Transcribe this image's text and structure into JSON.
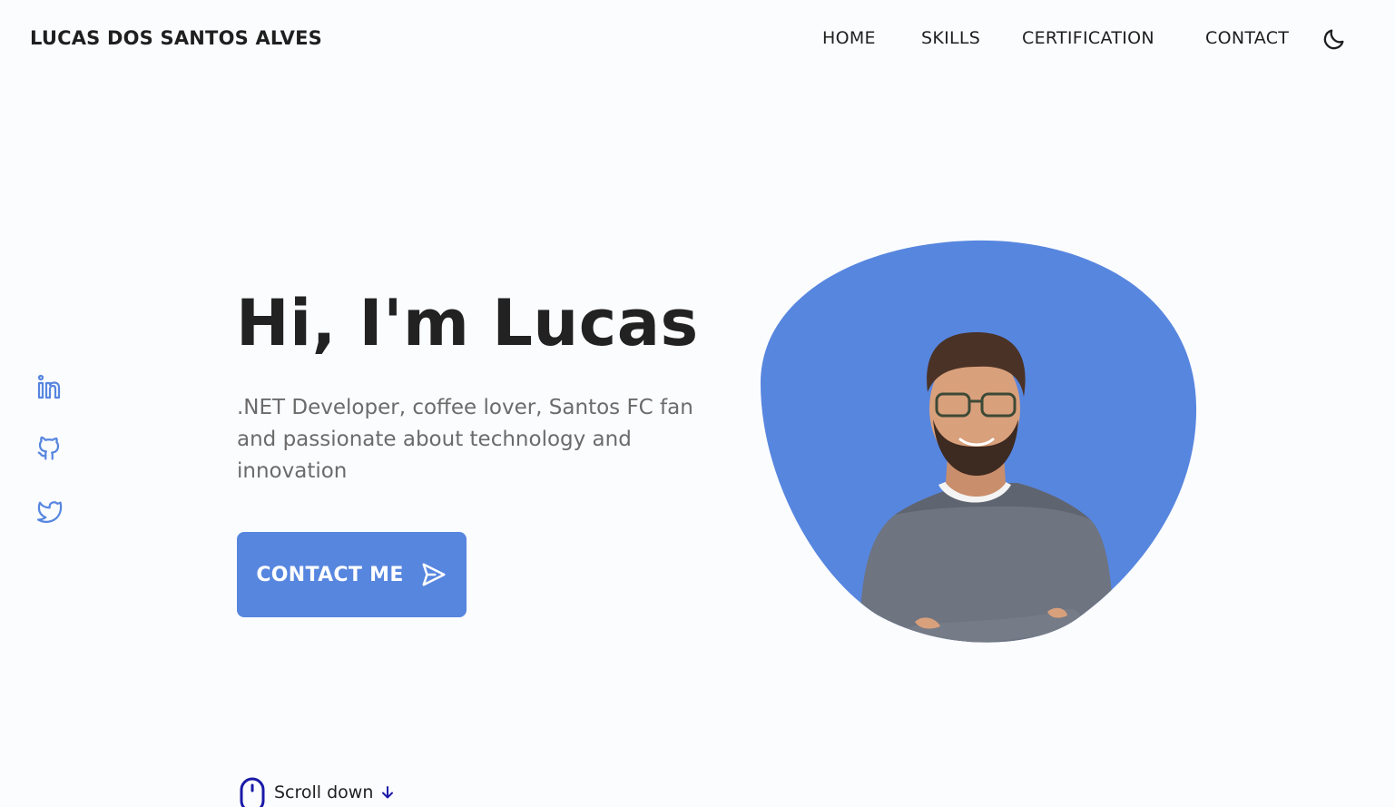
{
  "header": {
    "brand": "LUCAS DOS SANTOS ALVES",
    "nav": [
      {
        "label": "HOME"
      },
      {
        "label": "SKILLS"
      },
      {
        "label": "CERTIFICATION"
      },
      {
        "label": "CONTACT"
      }
    ],
    "theme_toggle_icon": "moon-icon"
  },
  "social": [
    "linkedin-icon",
    "github-icon",
    "twitter-icon"
  ],
  "hero": {
    "title": "Hi, I'm Lucas",
    "description": ".NET Developer, coffee lover, Santos FC fan and passionate about technology and innovation",
    "cta_label": "CONTACT ME",
    "cta_icon": "send-icon",
    "photo": "profile-photo"
  },
  "scroll": {
    "label": "Scroll down",
    "mouse_icon": "mouse-icon",
    "arrow_icon": "arrow-down-icon"
  },
  "colors": {
    "accent": "#5786df",
    "text": "#222222",
    "muted": "#6b6b6b",
    "background": "#fbfcfe",
    "scroll_icon": "#1a1aa8"
  }
}
